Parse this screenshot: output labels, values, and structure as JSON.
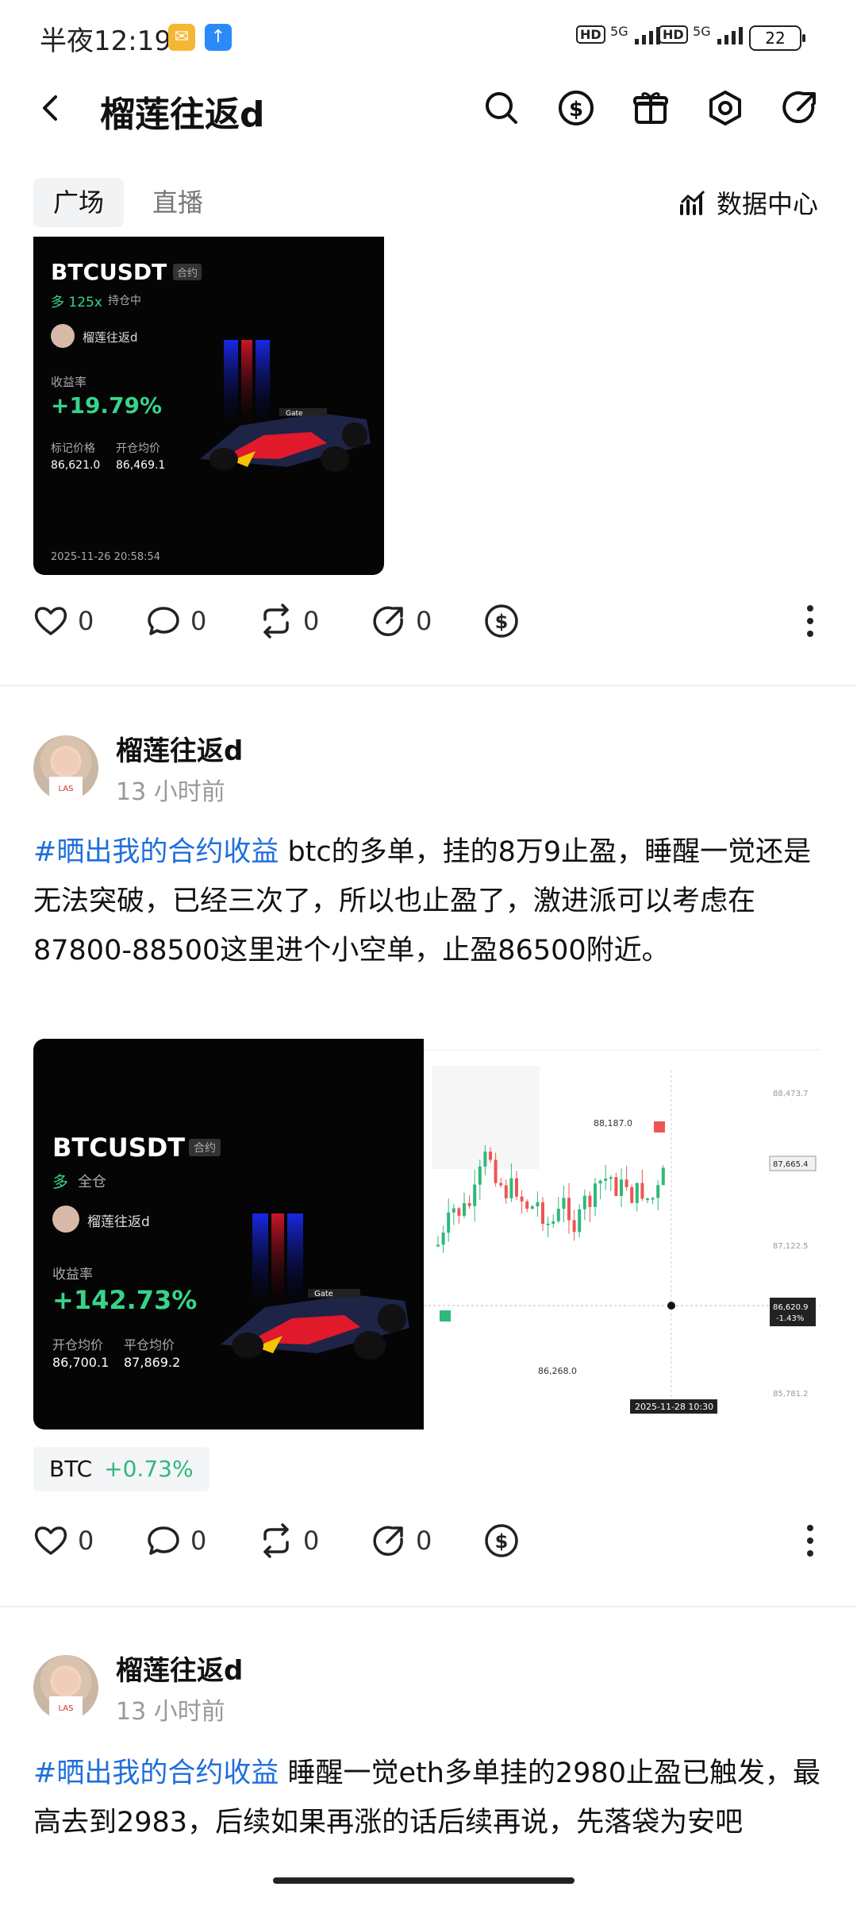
{
  "status_bar": {
    "time": "半夜12:19",
    "net1": "5G",
    "net2": "5G",
    "battery": "22",
    "hd": "HD"
  },
  "header": {
    "title": "榴莲往返d"
  },
  "tabs": [
    {
      "label": "广场"
    },
    {
      "label": "直播"
    }
  ],
  "data_center": "数据中心",
  "card1": {
    "symbol": "BTCUSDT",
    "tag": "合约",
    "direction": "多 125x",
    "status": "持仓中",
    "user": "榴莲往返d",
    "pnl_label": "收益率",
    "pnl": "+19.79%",
    "mark_label": "标记价格",
    "mark_value": "86,621.0",
    "open_label": "开仓均价",
    "open_value": "86,469.1",
    "timestamp": "2025-11-26 20:58:54"
  },
  "actions": {
    "like": "0",
    "comment": "0",
    "repost": "0",
    "share": "0"
  },
  "post1": {
    "author": "榴莲往返d",
    "time": "13 小时前",
    "hashtag": "#晒出我的合约收益",
    "text": " btc的多单，挂的8万9止盈，睡醒一觉还是无法突破，已经三次了，所以也止盈了，激进派可以考虑在87800-88500这里进个小空单，止盈86500附近。"
  },
  "card2": {
    "symbol": "BTCUSDT",
    "tag": "合约",
    "direction": "多",
    "status": "全仓",
    "user": "榴莲往返d",
    "pnl_label": "收益率",
    "pnl": "+142.73%",
    "open_label": "开仓均价",
    "open_value": "86,700.1",
    "close_label": "平仓均价",
    "close_value": "87,869.2"
  },
  "mini_chart": {
    "high_label": "88,187.0",
    "low_label": "86,268.0",
    "date_label": "2025-11-28 10:30",
    "right_ticks": [
      "88,473.7",
      "87,665.4",
      "87,122.5",
      "86,620.9",
      "85,781.2"
    ],
    "current": "86,620.9",
    "current_pct": "-1.43%"
  },
  "chip": {
    "symbol": "BTC",
    "change": "+0.73%"
  },
  "actions2": {
    "like": "0",
    "comment": "0",
    "repost": "0",
    "share": "0"
  },
  "post2": {
    "author": "榴莲往返d",
    "time": "13 小时前",
    "hashtag": "#晒出我的合约收益",
    "text": " 睡醒一觉eth多单挂的2980止盈已触发，最高去到2983，后续如果再涨的话后续再说，先落袋为安吧"
  },
  "colors": {
    "accent": "#1f6fdc",
    "profit": "#37d38a",
    "chip_green": "#2fb87a"
  }
}
